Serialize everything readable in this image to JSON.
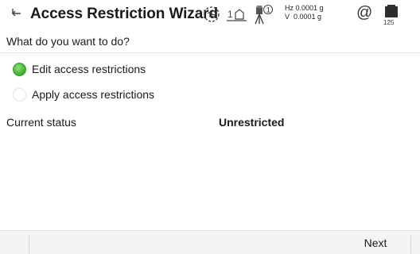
{
  "titlebar": {
    "title": "Access Restriction Wizard",
    "back_icon": "back-arrow-icon",
    "status_icons": [
      "globe-icon",
      "face-one-icon",
      "tripod-one-icon",
      "at-icon",
      "battery-icon"
    ],
    "face_label": "1",
    "tripod_label": "1",
    "angles": {
      "hz": "Hz 0.0001 g",
      "v": "V  0.0001 g"
    },
    "at_symbol": "@",
    "battery_label": "125"
  },
  "main": {
    "prompt": "What do you want to do?",
    "options": [
      {
        "label": "Edit access restrictions",
        "selected": true
      },
      {
        "label": "Apply access restrictions",
        "selected": false
      }
    ],
    "status": {
      "label": "Current status",
      "value": "Unrestricted"
    }
  },
  "softkeys": {
    "next_label": "Next"
  },
  "colors": {
    "radio_selected": "#4bb83b",
    "softkey_bar": "#f4f4f4"
  }
}
